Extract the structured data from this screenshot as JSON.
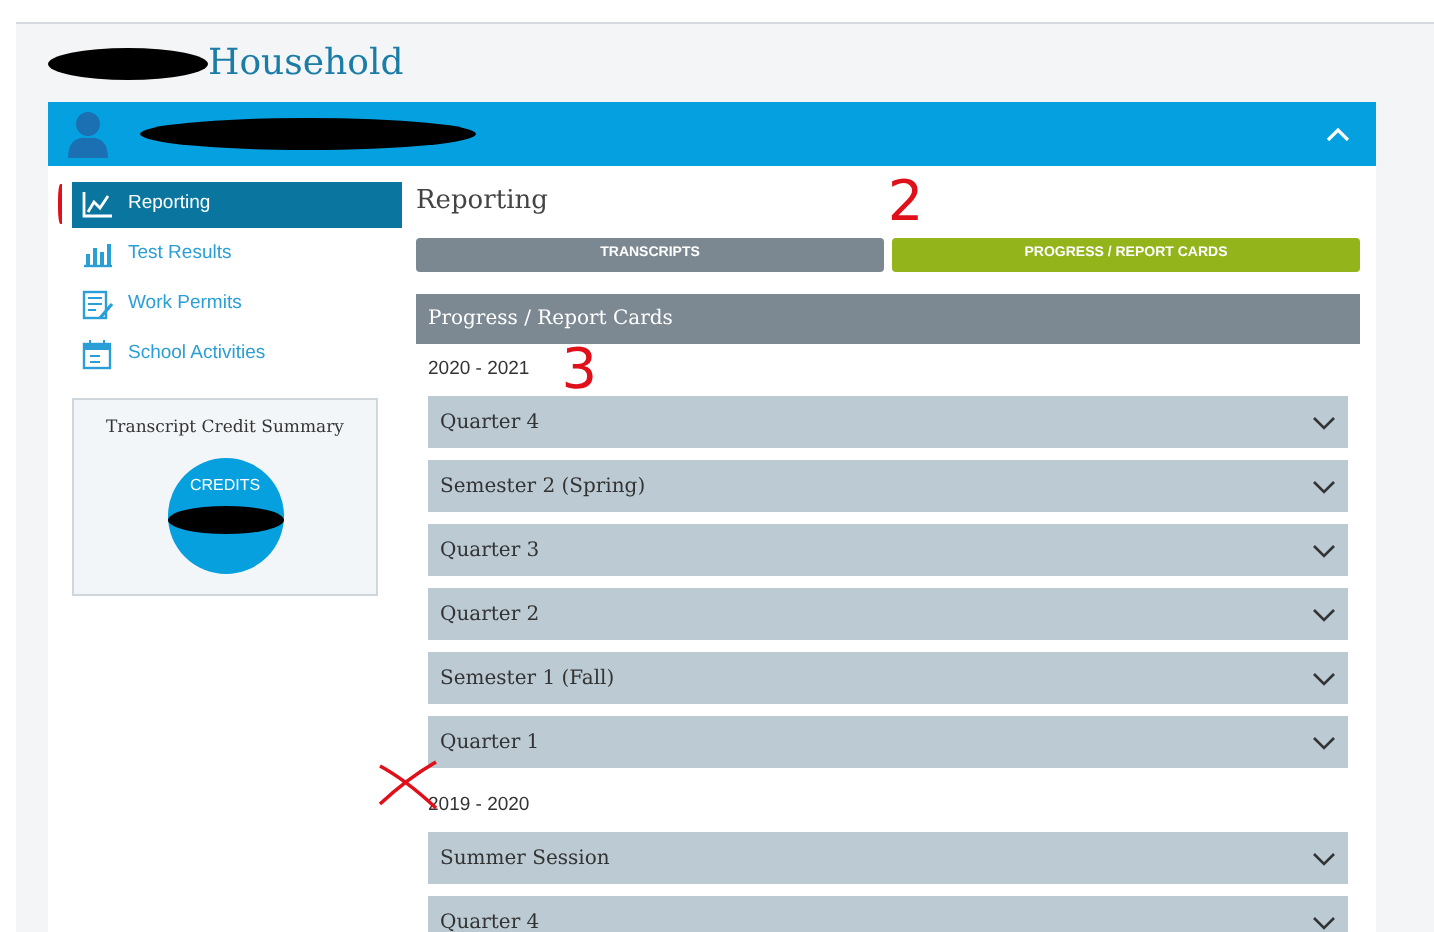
{
  "page_title": "Household",
  "student_bar": {
    "expanded": true
  },
  "sidebar": {
    "items": [
      {
        "label": "Reporting",
        "kind": "chart",
        "selected": true
      },
      {
        "label": "Test Results",
        "kind": "bars",
        "selected": false
      },
      {
        "label": "Work Permits",
        "kind": "permit",
        "selected": false
      },
      {
        "label": "School Activities",
        "kind": "calendar",
        "selected": false
      }
    ],
    "credit_summary": {
      "title": "Transcript Credit Summary",
      "label": "CREDITS"
    }
  },
  "main": {
    "title": "Reporting",
    "title_note": "2",
    "tabs": [
      {
        "label": "TRANSCRIPTS",
        "selected": false
      },
      {
        "label": "PROGRESS / REPORT CARDS",
        "selected": true
      }
    ],
    "panel": {
      "title": "Progress / Report Cards",
      "years": [
        {
          "label": "2020 - 2021",
          "note": "3",
          "crossed": false,
          "terms": [
            {
              "label": "Quarter 4",
              "expanded": false
            },
            {
              "label": "Semester 2 (Spring)",
              "expanded": false
            },
            {
              "label": "Quarter 3",
              "expanded": false
            },
            {
              "label": "Quarter 2",
              "expanded": false
            },
            {
              "label": "Semester 1 (Fall)",
              "expanded": false
            },
            {
              "label": "Quarter 1",
              "expanded": false
            }
          ]
        },
        {
          "label": "2019 - 2020",
          "crossed": true,
          "terms": [
            {
              "label": "Summer Session",
              "expanded": false
            },
            {
              "label": "Quarter 4",
              "expanded": false
            }
          ]
        }
      ]
    }
  }
}
